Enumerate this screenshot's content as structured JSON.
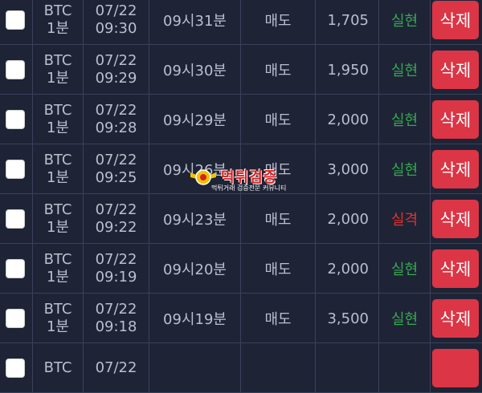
{
  "colors": {
    "background": "#1e2436",
    "border": "#39415a",
    "text": "#b9bfcc",
    "status_ok": "#35a84e",
    "status_fail": "#e0312f",
    "delete_button": "#dc3545"
  },
  "rows": [
    {
      "symbol": "BTC",
      "interval": "1분",
      "date": "07/22",
      "time": "09:30",
      "round": "09시31분",
      "side": "매도",
      "amount": "1,705",
      "status": "실현",
      "status_type": "ok",
      "delete_label": "삭제"
    },
    {
      "symbol": "BTC",
      "interval": "1분",
      "date": "07/22",
      "time": "09:29",
      "round": "09시30분",
      "side": "매도",
      "amount": "1,950",
      "status": "실현",
      "status_type": "ok",
      "delete_label": "삭제"
    },
    {
      "symbol": "BTC",
      "interval": "1분",
      "date": "07/22",
      "time": "09:28",
      "round": "09시29분",
      "side": "매도",
      "amount": "2,000",
      "status": "실현",
      "status_type": "ok",
      "delete_label": "삭제"
    },
    {
      "symbol": "BTC",
      "interval": "1분",
      "date": "07/22",
      "time": "09:25",
      "round": "09시26분",
      "side": "매도",
      "amount": "3,000",
      "status": "실현",
      "status_type": "ok",
      "delete_label": "삭제"
    },
    {
      "symbol": "BTC",
      "interval": "1분",
      "date": "07/22",
      "time": "09:22",
      "round": "09시23분",
      "side": "매도",
      "amount": "2,000",
      "status": "실격",
      "status_type": "fail",
      "delete_label": "삭제"
    },
    {
      "symbol": "BTC",
      "interval": "1분",
      "date": "07/22",
      "time": "09:19",
      "round": "09시20분",
      "side": "매도",
      "amount": "2,000",
      "status": "실현",
      "status_type": "ok",
      "delete_label": "삭제"
    },
    {
      "symbol": "BTC",
      "interval": "1분",
      "date": "07/22",
      "time": "09:18",
      "round": "09시19분",
      "side": "매도",
      "amount": "3,500",
      "status": "실현",
      "status_type": "ok",
      "delete_label": "삭제"
    },
    {
      "symbol": "BTC",
      "interval": "",
      "date": "07/22",
      "time": "",
      "round": "",
      "side": "",
      "amount": "",
      "status": "",
      "status_type": "ok",
      "delete_label": ""
    }
  ],
  "watermark": {
    "title": "먹튀검증",
    "subtitle": "먹튀거래 검증전문 커뮤니티"
  }
}
